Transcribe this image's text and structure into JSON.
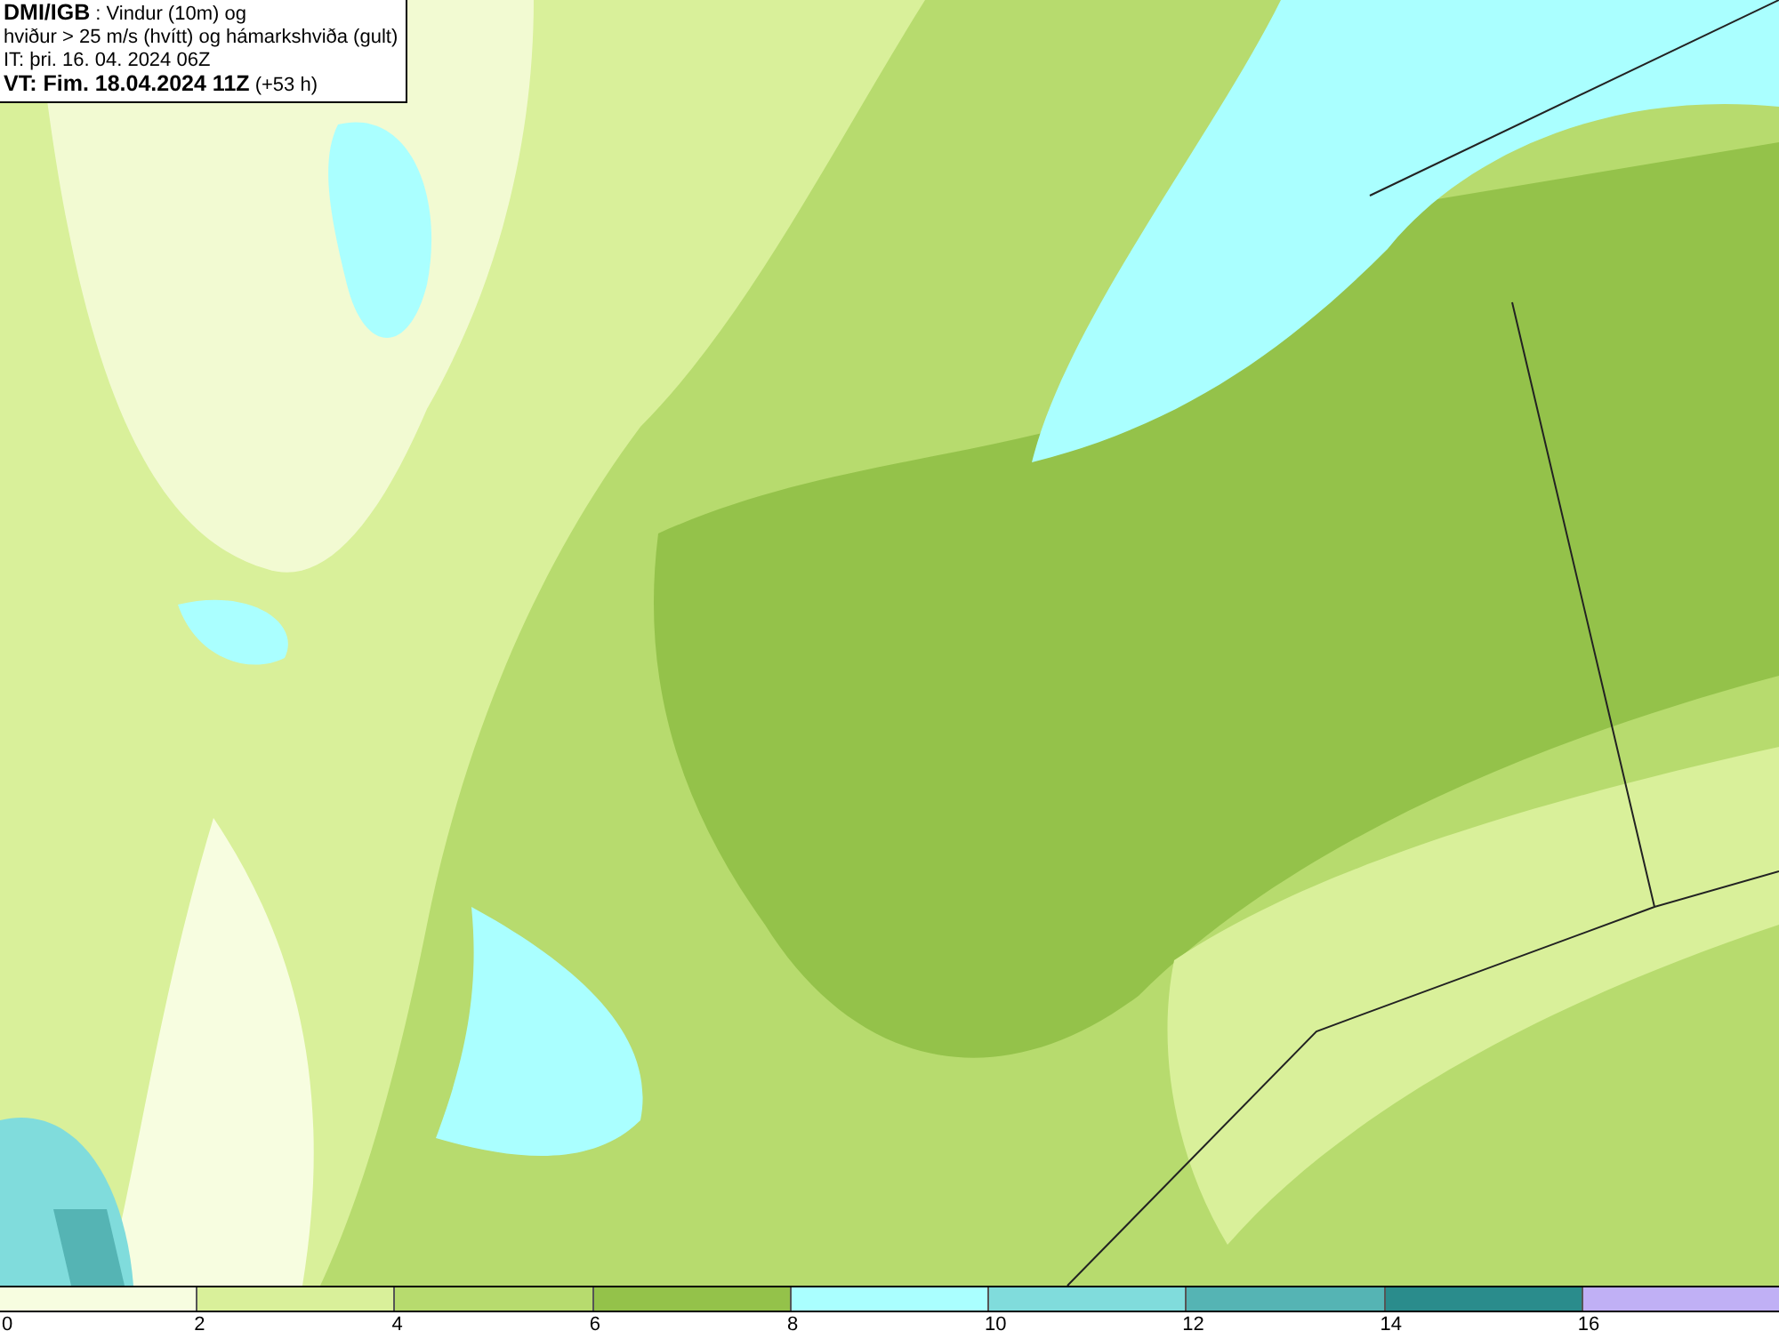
{
  "header": {
    "lines": [
      "**DMI/IGB** : Vindur (10m) og",
      "hviður > 25 m/s (hvítt) og hámarkshviða (gult)",
      "IT: þri. 16. 04. 2024 06Z",
      "**VT: Fim. 18.04.2024 11Z** (+53 h)"
    ]
  },
  "legend": {
    "segments": [
      {
        "label": "0",
        "color": "#f7fde0"
      },
      {
        "label": "2",
        "color": "#d9f09a"
      },
      {
        "label": "4",
        "color": "#b7db6e"
      },
      {
        "label": "6",
        "color": "#94c24a"
      },
      {
        "label": "8",
        "color": "#aaffff"
      },
      {
        "label": "10",
        "color": "#80dcdc"
      },
      {
        "label": "12",
        "color": "#55b4b4"
      },
      {
        "label": "14",
        "color": "#2a8c8c"
      },
      {
        "label": "16",
        "color": "#c0b0f5"
      }
    ]
  }
}
